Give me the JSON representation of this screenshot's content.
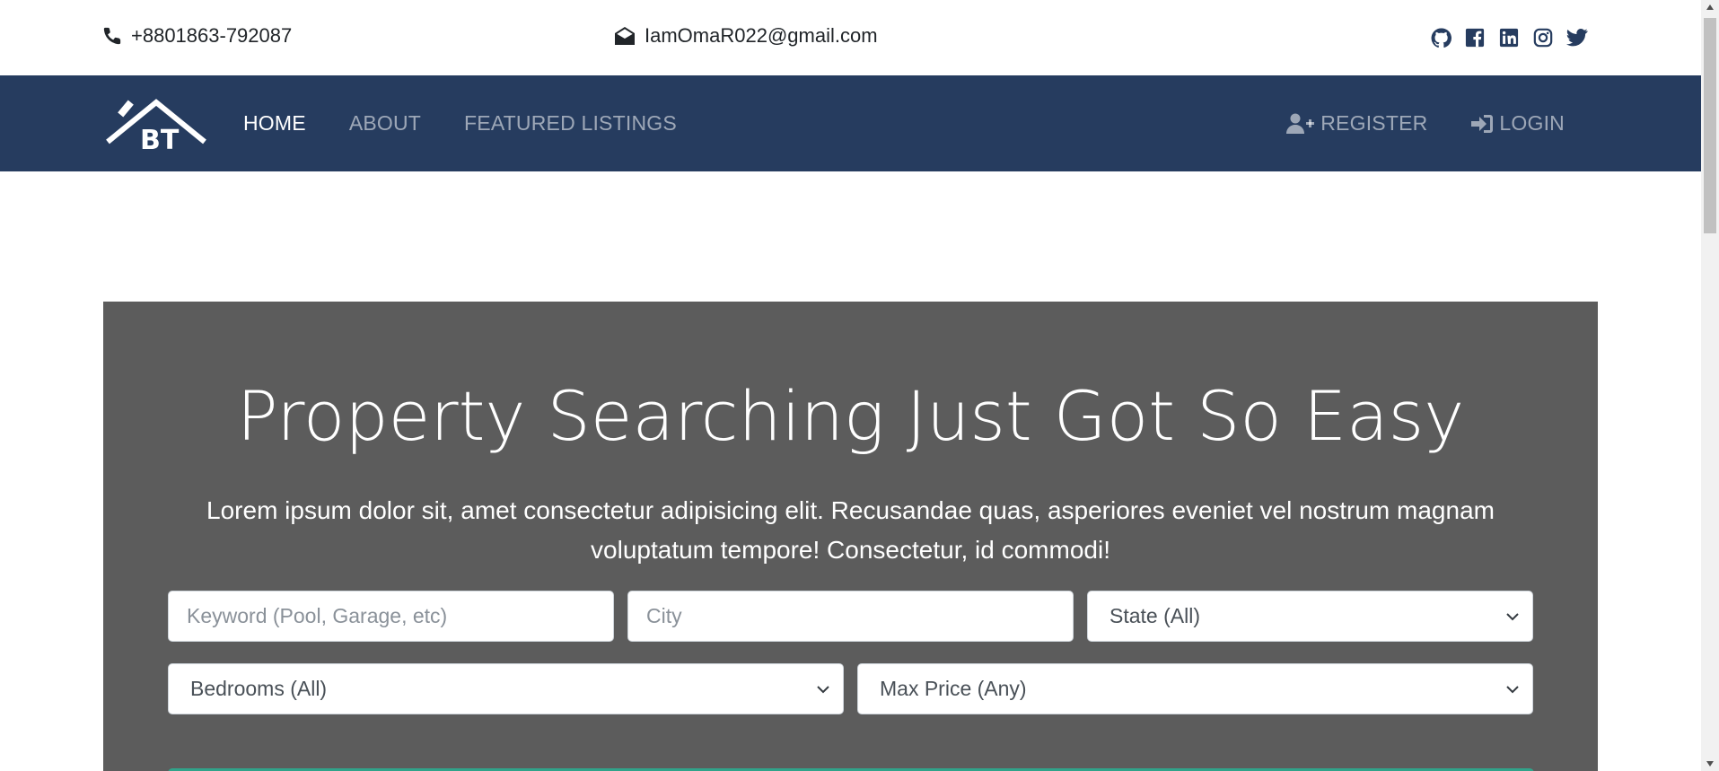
{
  "topbar": {
    "phone": "+8801863-792087",
    "email": "IamOmaR022@gmail.com",
    "socials": [
      "github-icon",
      "facebook-icon",
      "linkedin-icon",
      "instagram-icon",
      "twitter-icon"
    ]
  },
  "navbar": {
    "logo_text": "BT",
    "links": [
      {
        "label": "HOME",
        "active": true
      },
      {
        "label": "ABOUT",
        "active": false
      },
      {
        "label": "FEATURED LISTINGS",
        "active": false
      }
    ],
    "register": "REGISTER",
    "login": "LOGIN",
    "bg_color": "#263c5f"
  },
  "hero": {
    "title": "Property Searching Just Got So Easy",
    "text": "Lorem ipsum dolor sit, amet consectetur adipisicing elit. Recusandae quas, asperiores eveniet vel nostrum magnam voluptatum tempore! Consectetur, id commodi!",
    "bg_color": "#5c5c5c"
  },
  "search": {
    "keyword_placeholder": "Keyword (Pool, Garage, etc)",
    "city_placeholder": "City",
    "state_selected": "State (All)",
    "bedrooms_selected": "Bedrooms (All)",
    "price_selected": "Max Price (Any)",
    "button_color": "#30a38a"
  }
}
